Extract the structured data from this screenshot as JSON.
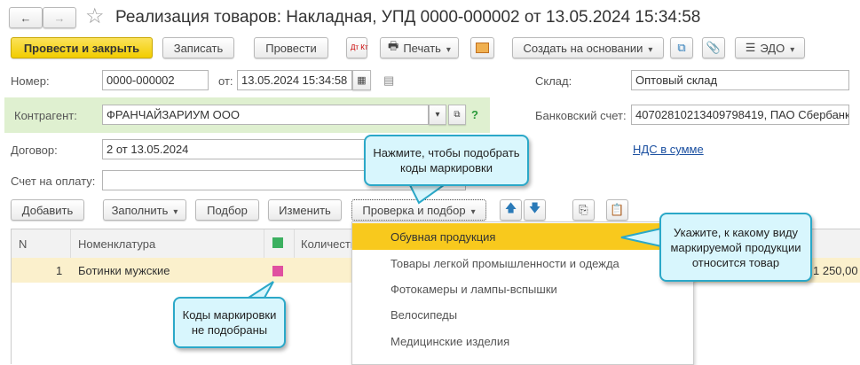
{
  "title": "Реализация товаров: Накладная, УПД 0000-000002 от 13.05.2024 15:34:58",
  "toolbar": {
    "post_close": "Провести и закрыть",
    "save": "Записать",
    "post": "Провести",
    "dtkt": "Дт Кт",
    "print": "Печать",
    "create_based": "Создать на основании",
    "edo": "ЭДО"
  },
  "form": {
    "number_label": "Номер:",
    "number": "0000-000002",
    "date_label": "от:",
    "date": "13.05.2024 15:34:58",
    "warehouse_label": "Склад:",
    "warehouse": "Оптовый склад",
    "counterparty_label": "Контрагент:",
    "counterparty": "ФРАНЧАЙЗАРИУМ ООО",
    "help": "?",
    "bank_label": "Банковский счет:",
    "bank": "40702810213409798419, ПАО Сбербанк",
    "contract_label": "Договор:",
    "contract": "2 от 13.05.2024",
    "vat_link": "НДС в сумме",
    "invoice_label": "Счет на оплату:",
    "invoice": ""
  },
  "table_toolbar": {
    "add": "Добавить",
    "fill": "Заполнить",
    "select": "Подбор",
    "edit": "Изменить",
    "check": "Проверка и подбор"
  },
  "table": {
    "headers": [
      "N",
      "Номенклатура",
      "",
      "Количество"
    ],
    "rows": [
      {
        "n": "1",
        "name": "Ботинки мужские",
        "sum": "1 250,00"
      }
    ]
  },
  "menu": [
    "Обувная продукция",
    "Товары легкой промышленности и одежда",
    "Фотокамеры и лампы-вспышки",
    "Велосипеды",
    "Медицинские изделия"
  ],
  "callouts": {
    "pick": "Нажмите, чтобы подобрать коды маркировки",
    "kind": "Укажите, к какому виду маркируемой продукции относится товар",
    "codes": "Коды маркировки не подобраны"
  },
  "colors": {
    "accent": "#f5d10c",
    "highlight": "#f8c91d",
    "row": "#fbf0cc",
    "callout": "#d8f6fd"
  }
}
